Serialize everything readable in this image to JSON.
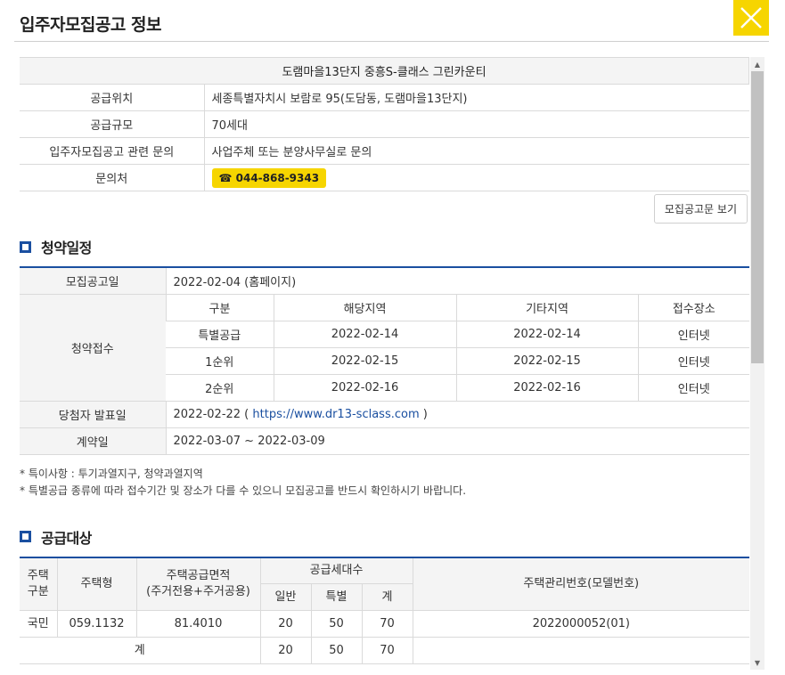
{
  "modal": {
    "title": "입주자모집공고 정보",
    "close_icon": "close-icon"
  },
  "complex": {
    "name": "도램마을13단지 중흥S-클래스 그린카운티",
    "rows": [
      {
        "label": "공급위치",
        "value": "세종특별자치시 보람로 95(도담동, 도램마을13단지)"
      },
      {
        "label": "공급규모",
        "value": "70세대"
      },
      {
        "label": "입주자모집공고 관련 문의",
        "value": "사업주체 또는 분양사무실로 문의"
      },
      {
        "label": "문의처",
        "value": "☎ 044-868-9343"
      }
    ],
    "doc_button": "모집공고문 보기"
  },
  "schedule": {
    "heading": "청약일정",
    "announce_label": "모집공고일",
    "announce_value": "2022-02-04 (홈페이지)",
    "apply_label": "청약접수",
    "columns": [
      "구분",
      "해당지역",
      "기타지역",
      "접수장소"
    ],
    "rows": [
      {
        "type": "특별공급",
        "local": "2022-02-14",
        "other": "2022-02-14",
        "place": "인터넷"
      },
      {
        "type": "1순위",
        "local": "2022-02-15",
        "other": "2022-02-15",
        "place": "인터넷"
      },
      {
        "type": "2순위",
        "local": "2022-02-16",
        "other": "2022-02-16",
        "place": "인터넷"
      }
    ],
    "winner_label": "당첨자 발표일",
    "winner_date": "2022-02-22 (",
    "winner_link": "https://www.dr13-sclass.com",
    "winner_close": ")",
    "contract_label": "계약일",
    "contract_value": "2022-03-07 ~ 2022-03-09"
  },
  "notes": [
    "* 특이사항 : 투기과열지구, 청약과열지역",
    "* 특별공급 종류에 따라 접수기간 및 장소가 다를 수 있으니 모집공고를 반드시 확인하시기 바랍니다."
  ],
  "supply": {
    "heading": "공급대상",
    "headers": {
      "house_kind": "주택\n구분",
      "house_type": "주택형",
      "area": "주택공급면적\n(주거전용+주거공용)",
      "units": "공급세대수",
      "general": "일반",
      "special": "특별",
      "total": "계",
      "mgmt": "주택관리번호(모델번호)"
    },
    "rows": [
      {
        "kind": "국민",
        "type": "059.1132",
        "area": "81.4010",
        "general": "20",
        "special": "50",
        "total": "70",
        "mgmt": "2022000052(01)"
      }
    ],
    "sum_label": "계",
    "sum_general": "20",
    "sum_special": "50",
    "sum_total": "70"
  }
}
